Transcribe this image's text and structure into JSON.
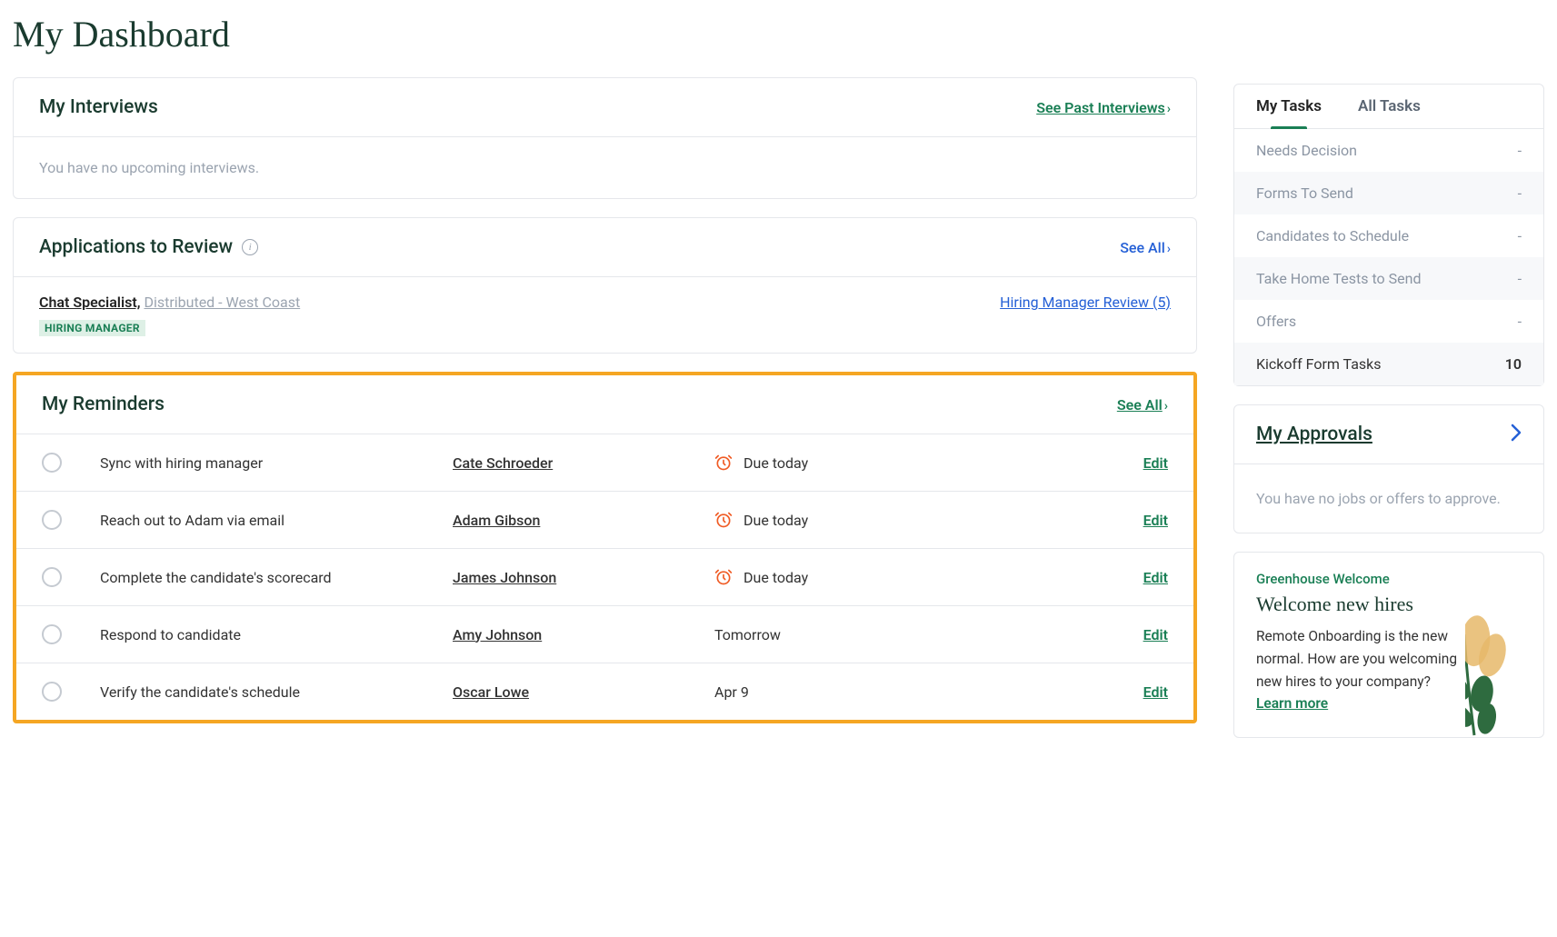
{
  "page": {
    "title": "My Dashboard"
  },
  "interviews": {
    "title": "My Interviews",
    "see_past_label": "See Past Interviews",
    "empty_msg": "You have no upcoming interviews."
  },
  "applications": {
    "title": "Applications to Review",
    "see_all_label": "See All",
    "job_name": "Chat Specialist,",
    "job_location": "Distributed - West Coast",
    "badge": "HIRING MANAGER",
    "stage_link": "Hiring Manager Review (5)"
  },
  "reminders": {
    "title": "My Reminders",
    "see_all_label": "See All",
    "edit_label": "Edit",
    "items": [
      {
        "task": "Sync with hiring manager",
        "person": "Cate Schroeder",
        "due": "Due today",
        "alarm": true
      },
      {
        "task": "Reach out to Adam via email",
        "person": "Adam Gibson",
        "due": "Due today",
        "alarm": true
      },
      {
        "task": "Complete the candidate's scorecard",
        "person": "James Johnson",
        "due": "Due today",
        "alarm": true
      },
      {
        "task": "Respond to candidate",
        "person": "Amy Johnson",
        "due": "Tomorrow",
        "alarm": false
      },
      {
        "task": "Verify the candidate's schedule",
        "person": "Oscar Lowe",
        "due": "Apr 9",
        "alarm": false
      }
    ]
  },
  "tasks": {
    "tabs": {
      "my": "My Tasks",
      "all": "All Tasks"
    },
    "rows": [
      {
        "name": "Needs Decision",
        "value": "-",
        "bold": false
      },
      {
        "name": "Forms To Send",
        "value": "-",
        "bold": false
      },
      {
        "name": "Candidates to Schedule",
        "value": "-",
        "bold": false
      },
      {
        "name": "Take Home Tests to Send",
        "value": "-",
        "bold": false
      },
      {
        "name": "Offers",
        "value": "-",
        "bold": false
      },
      {
        "name": "Kickoff Form Tasks",
        "value": "10",
        "bold": true
      }
    ]
  },
  "approvals": {
    "title": "My Approvals",
    "empty_msg": "You have no jobs or offers to approve."
  },
  "welcome": {
    "eyebrow": "Greenhouse Welcome",
    "heading": "Welcome new hires",
    "body_before": "Remote Onboarding is the new normal. How are you welcoming new hires to your company? ",
    "learn_more": "Learn more"
  }
}
